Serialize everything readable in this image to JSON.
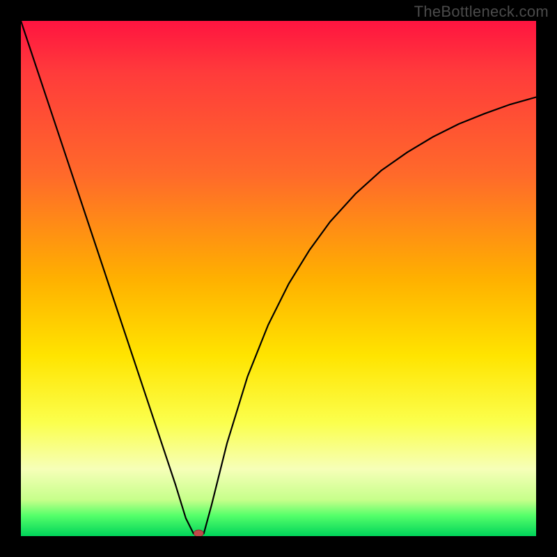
{
  "watermark": "TheBottleneck.com",
  "chart_data": {
    "type": "line",
    "title": "",
    "xlabel": "",
    "ylabel": "",
    "xlim": [
      0,
      1
    ],
    "ylim": [
      0,
      1
    ],
    "background_gradient": {
      "direction": "top-to-bottom",
      "stops": [
        {
          "pos": 0.0,
          "color": "#ff1440"
        },
        {
          "pos": 0.1,
          "color": "#ff3b3b"
        },
        {
          "pos": 0.3,
          "color": "#ff6a2a"
        },
        {
          "pos": 0.5,
          "color": "#ffb000"
        },
        {
          "pos": 0.65,
          "color": "#ffe400"
        },
        {
          "pos": 0.78,
          "color": "#fbff4d"
        },
        {
          "pos": 0.87,
          "color": "#f6ffb8"
        },
        {
          "pos": 0.93,
          "color": "#c6ff8a"
        },
        {
          "pos": 0.96,
          "color": "#55ff6a"
        },
        {
          "pos": 1.0,
          "color": "#00d45a"
        }
      ]
    },
    "series": [
      {
        "name": "bottleneck-curve",
        "x": [
          0.0,
          0.03,
          0.06,
          0.09,
          0.12,
          0.15,
          0.18,
          0.21,
          0.24,
          0.27,
          0.3,
          0.32,
          0.335,
          0.345,
          0.355,
          0.37,
          0.4,
          0.44,
          0.48,
          0.52,
          0.56,
          0.6,
          0.65,
          0.7,
          0.75,
          0.8,
          0.85,
          0.9,
          0.95,
          1.0
        ],
        "y": [
          1.0,
          0.91,
          0.82,
          0.73,
          0.64,
          0.55,
          0.46,
          0.37,
          0.28,
          0.19,
          0.1,
          0.035,
          0.005,
          0.0,
          0.005,
          0.06,
          0.18,
          0.31,
          0.41,
          0.49,
          0.555,
          0.61,
          0.665,
          0.71,
          0.745,
          0.775,
          0.8,
          0.82,
          0.838,
          0.852
        ]
      }
    ],
    "optimum_marker": {
      "x": 0.345,
      "y": 0.0
    }
  }
}
